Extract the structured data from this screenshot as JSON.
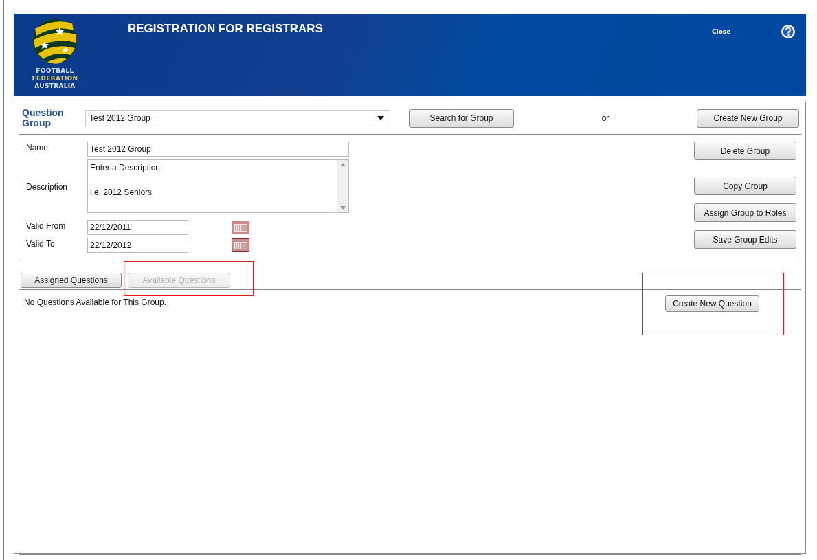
{
  "header": {
    "logo_lines": [
      "FOOTBALL",
      "FEDERATION",
      "AUSTRALIA"
    ],
    "title": "REGISTRATION FOR REGISTRARS",
    "close": "Close"
  },
  "question_group": {
    "label": "Question Group",
    "value": "Test 2012 Group",
    "search_button": "Search for Group",
    "separator": "or",
    "create_button": "Create New Group"
  },
  "details": {
    "fields": [
      {
        "kind": "text",
        "label": "Name",
        "value": "Test 2012 Group"
      },
      {
        "kind": "textarea",
        "label": "Description",
        "lines": [
          "Enter a Description.",
          "i.e. 2012 Seniors"
        ]
      },
      {
        "kind": "date",
        "label": "Valid From",
        "value": "22/12/2011"
      },
      {
        "kind": "date",
        "label": "Valid To",
        "value": "22/12/2012"
      }
    ],
    "buttons": [
      "Delete Group",
      "Copy Group",
      "Assign Group to Roles",
      "Save Group Edits"
    ]
  },
  "tabs": [
    {
      "label": "Assigned Questions",
      "selected": true
    },
    {
      "label": "Available Questions",
      "selected": false
    }
  ],
  "questions": {
    "message": "No Questions Available for This Group.",
    "create_button": "Create New Question"
  },
  "annotations": [
    {
      "kind": "highlight"
    },
    {
      "kind": "highlight"
    }
  ]
}
